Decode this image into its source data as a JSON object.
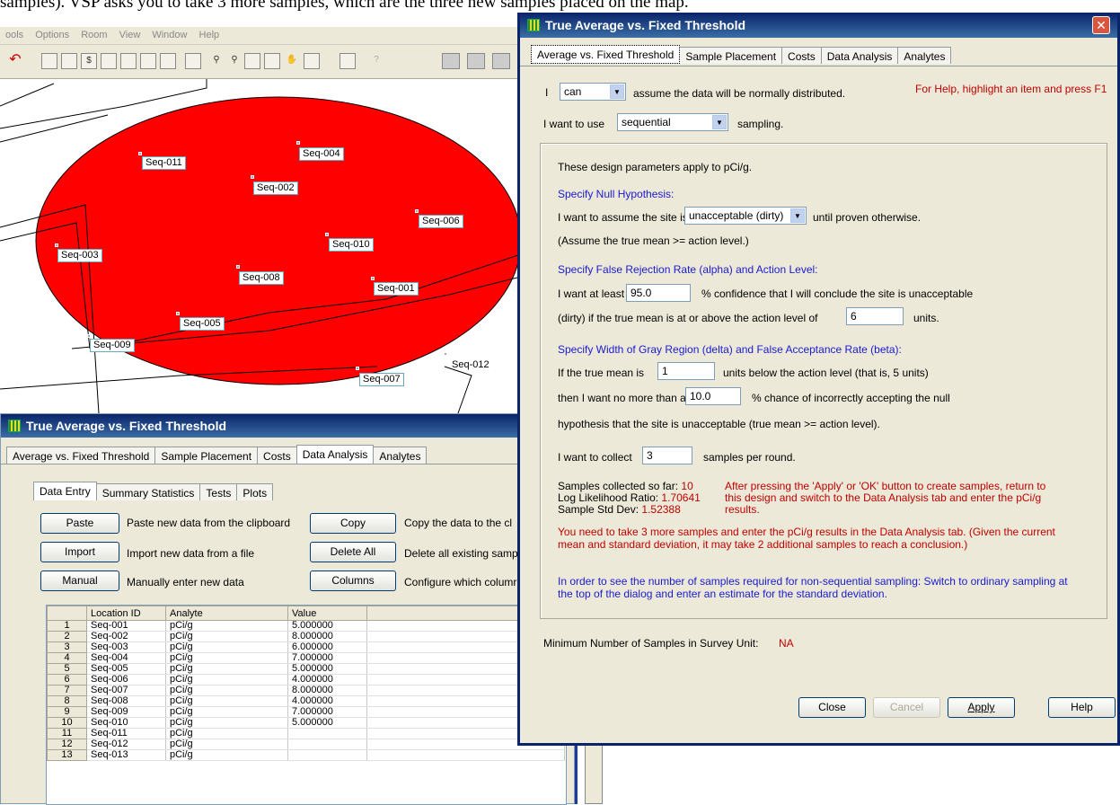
{
  "doc_text": "samples). VSP asks you to take 3 more samples, which are the three new samples placed on the map.",
  "bg_menu": [
    "ools",
    "Options",
    "Room",
    "View",
    "Window",
    "Help"
  ],
  "map_labels": [
    {
      "text": "Seq-011"
    },
    {
      "text": "Seq-004"
    },
    {
      "text": "Seq-002"
    },
    {
      "text": "Seq-006"
    },
    {
      "text": "Seq-003"
    },
    {
      "text": "Seq-010"
    },
    {
      "text": "Seq-008"
    },
    {
      "text": "Seq-001"
    },
    {
      "text": "Seq-005"
    },
    {
      "text": "Seq-009"
    },
    {
      "text": "Seq-007"
    },
    {
      "text": "Seq-012"
    }
  ],
  "colors": {
    "ellipse": "#ff0000",
    "title_bar": "#0a246a",
    "blue_text": "#1a1ad0",
    "red_text": "#c00000"
  },
  "lower_dialog": {
    "title": "True Average vs. Fixed Threshold",
    "tabs": [
      "Average vs. Fixed Threshold",
      "Sample Placement",
      "Costs",
      "Data Analysis",
      "Analytes"
    ],
    "active_tab": "Data Analysis",
    "subtabs": [
      "Data Entry",
      "Summary Statistics",
      "Tests",
      "Plots"
    ],
    "buttons": {
      "paste": "Paste",
      "paste_desc": "Paste new data from the clipboard",
      "import": "Import",
      "import_desc": "Import new data from a file",
      "manual": "Manual",
      "manual_desc": "Manually enter new data",
      "copy": "Copy",
      "copy_desc": "Copy the data to the cl",
      "delete_all": "Delete All",
      "delete_desc": "Delete all existing samp",
      "columns": "Columns",
      "columns_desc": "Configure which columr"
    },
    "grid_headers": [
      "Location ID",
      "Analyte",
      "Value"
    ],
    "grid_rows": [
      [
        "1",
        "Seq-001",
        "pCi/g",
        "5.000000"
      ],
      [
        "2",
        "Seq-002",
        "pCi/g",
        "8.000000"
      ],
      [
        "3",
        "Seq-003",
        "pCi/g",
        "6.000000"
      ],
      [
        "4",
        "Seq-004",
        "pCi/g",
        "7.000000"
      ],
      [
        "5",
        "Seq-005",
        "pCi/g",
        "5.000000"
      ],
      [
        "6",
        "Seq-006",
        "pCi/g",
        "4.000000"
      ],
      [
        "7",
        "Seq-007",
        "pCi/g",
        "8.000000"
      ],
      [
        "8",
        "Seq-008",
        "pCi/g",
        "4.000000"
      ],
      [
        "9",
        "Seq-009",
        "pCi/g",
        "7.000000"
      ],
      [
        "10",
        "Seq-010",
        "pCi/g",
        "5.000000"
      ],
      [
        "11",
        "Seq-011",
        "pCi/g",
        ""
      ],
      [
        "12",
        "Seq-012",
        "pCi/g",
        ""
      ],
      [
        "13",
        "Seq-013",
        "pCi/g",
        ""
      ]
    ]
  },
  "main_dialog": {
    "title": "True Average vs. Fixed Threshold",
    "close_glyph": "✕",
    "tabs": [
      "Average vs. Fixed Threshold",
      "Sample Placement",
      "Costs",
      "Data Analysis",
      "Analytes"
    ],
    "active_tab": "Average vs. Fixed Threshold",
    "i_label": "I",
    "can_value": "can",
    "normal_text": "assume the data will be normally distributed.",
    "help_hint": "For Help, highlight an item and press F1",
    "use_label": "I want to use",
    "sampling_value": "sequential",
    "sampling_suffix": "sampling.",
    "apply_text": "These design parameters apply to pCi/g.",
    "null_heading": "Specify Null Hypothesis:",
    "assume_prefix": "I want to assume the site is",
    "assume_value": "unacceptable (dirty)",
    "assume_suffix": "until proven otherwise.",
    "assume_note": "(Assume the true mean >= action level.)",
    "alpha_heading": "Specify False Rejection Rate (alpha) and Action Level:",
    "atleast_prefix": "I want at least",
    "confidence_value": "95.0",
    "confidence_suffix": "% confidence that I will conclude the site is unacceptable",
    "dirty_text": "(dirty) if the true mean is at or above the action level of",
    "action_level": "6",
    "units": "units.",
    "delta_heading": "Specify Width of Gray Region (delta) and False Acceptance Rate (beta):",
    "truemean_prefix": "If the true mean is",
    "delta_value": "1",
    "truemean_suffix": "units below the action level (that is, 5 units)",
    "then_prefix": "then I want no more than a",
    "beta_value": "10.0",
    "then_suffix": "% chance of incorrectly accepting the null",
    "hyp_text": "hypothesis that the site is unacceptable (true mean >= action level).",
    "collect_prefix": "I want to collect",
    "collect_value": "3",
    "collect_suffix": "samples per round.",
    "stats": {
      "collected_label": "Samples collected so far:",
      "collected_value": "10",
      "llr_label": "Log Likelihood Ratio:",
      "llr_value": "1.70641",
      "sd_label": "Sample Std Dev:",
      "sd_value": "1.52388"
    },
    "after_note_1": "After pressing the 'Apply' or 'OK' button to create samples, return to",
    "after_note_2": "this design and switch to the Data Analysis tab and enter the pCi/g",
    "after_note_3": "results.",
    "need_note_1": "You need to take 3 more samples and enter the pCi/g results in the Data Analysis tab.  (Given the current",
    "need_note_2": "mean and standard deviation, it may take 2 additional samples to reach a conclusion.)",
    "order_note_1": "In order to see the number of samples required for non-sequential sampling:  Switch to ordinary sampling at",
    "order_note_2": "the top of the dialog and enter an estimate for the standard deviation.",
    "min_label": "Minimum Number of Samples in Survey Unit:",
    "min_value": "NA",
    "buttons": {
      "close": "Close",
      "cancel": "Cancel",
      "apply": "Apply",
      "help": "Help"
    }
  }
}
